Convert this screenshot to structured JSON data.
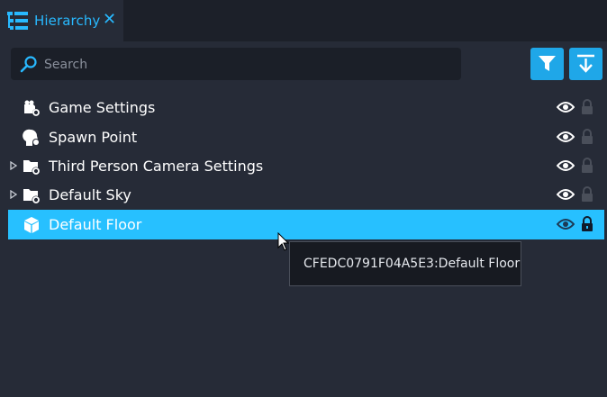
{
  "tab": {
    "title": "Hierarchy"
  },
  "search": {
    "placeholder": "Search",
    "value": ""
  },
  "toolbar": {
    "filter_icon": "filter-icon",
    "sort_icon": "arrow-down-to-line-icon"
  },
  "rows": [
    {
      "label": "Game Settings",
      "icon": "gear-camera-icon",
      "expandable": false,
      "visible": true,
      "locked": false,
      "selected": false
    },
    {
      "label": "Spawn Point",
      "icon": "spawn-head-icon",
      "expandable": false,
      "visible": true,
      "locked": false,
      "selected": false
    },
    {
      "label": "Third Person Camera Settings",
      "icon": "folder-gear-icon",
      "expandable": true,
      "visible": true,
      "locked": false,
      "selected": false
    },
    {
      "label": "Default Sky",
      "icon": "folder-gear-icon",
      "expandable": true,
      "visible": true,
      "locked": false,
      "selected": false
    },
    {
      "label": "Default Floor",
      "icon": "cube-icon",
      "expandable": false,
      "visible": true,
      "locked": true,
      "selected": true
    }
  ],
  "tooltip": {
    "text": "CFEDC0791F04A5E3:Default Floor"
  },
  "colors": {
    "accent": "#27c0ff",
    "background": "#262b37",
    "panel": "#1b1f28"
  }
}
